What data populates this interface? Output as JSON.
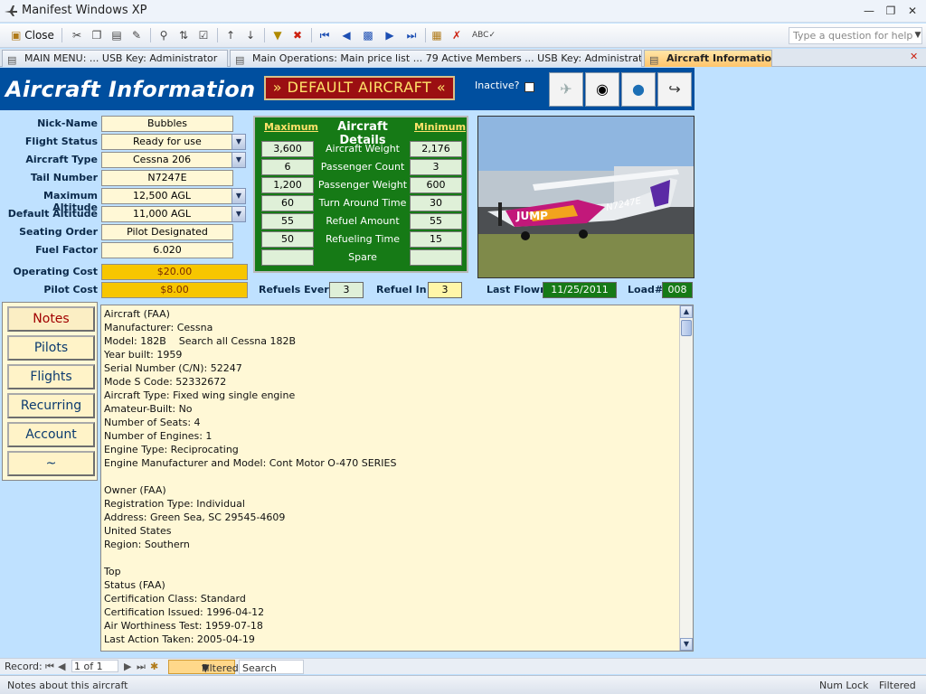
{
  "window": {
    "title": "Manifest Windows XP"
  },
  "toolbar": {
    "close_label": "Close",
    "help_placeholder": "Type a question for help"
  },
  "tabs": [
    {
      "label": "MAIN MENU:  ... USB Key:  Administrator",
      "active": false
    },
    {
      "label": "Main Operations:  Main price list ... 79 Active Members ... USB Key:  Administrator",
      "active": false
    },
    {
      "label": "Aircraft Information",
      "active": true
    }
  ],
  "header": {
    "title": "Aircraft Information",
    "default_aircraft": "» DEFAULT AIRCRAFT «",
    "inactive_label": "Inactive?"
  },
  "fields": {
    "nick_name": {
      "label": "Nick-Name",
      "value": "Bubbles"
    },
    "flight_status": {
      "label": "Flight Status",
      "value": "Ready for use"
    },
    "aircraft_type": {
      "label": "Aircraft Type",
      "value": "Cessna 206"
    },
    "tail_number": {
      "label": "Tail Number",
      "value": "N7247E"
    },
    "max_altitude": {
      "label": "Maximum Altitude",
      "value": "12,500 AGL"
    },
    "default_altitude": {
      "label": "Default Altitude",
      "value": "11,000 AGL"
    },
    "seating_order": {
      "label": "Seating Order",
      "value": "Pilot Designated"
    },
    "fuel_factor": {
      "label": "Fuel Factor",
      "value": "6.020"
    },
    "operating_cost": {
      "label": "Operating Cost",
      "value": "$20.00"
    },
    "pilot_cost": {
      "label": "Pilot Cost",
      "value": "$8.00"
    }
  },
  "details": {
    "title": "Aircraft Details",
    "max_header": "Maximum",
    "min_header": "Minimum",
    "rows": [
      {
        "label": "Aircraft Weight",
        "max": "3,600",
        "min": "2,176"
      },
      {
        "label": "Passenger Count",
        "max": "6",
        "min": "3"
      },
      {
        "label": "Passenger Weight",
        "max": "1,200",
        "min": "600"
      },
      {
        "label": "Turn Around Time",
        "max": "60",
        "min": "30"
      },
      {
        "label": "Refuel Amount",
        "max": "55",
        "min": "55"
      },
      {
        "label": "Refueling Time",
        "max": "50",
        "min": "15"
      },
      {
        "label": "Spare",
        "max": "",
        "min": ""
      }
    ]
  },
  "photo": {
    "tail_text": "N7247E",
    "livery_text": "JUMP"
  },
  "refuel": {
    "every_label": "Refuels Every",
    "every_value": "3",
    "in_label": "Refuel In",
    "in_value": "3",
    "last_flown_label": "Last Flown",
    "last_flown_value": "11/25/2011",
    "load_label": "Load#",
    "load_value": "008"
  },
  "side_buttons": [
    "Notes",
    "Pilots",
    "Flights",
    "Recurring",
    "Account",
    "~"
  ],
  "notes": "Aircraft (FAA)\nManufacturer: Cessna\nModel: 182B    Search all Cessna 182B\nYear built: 1959\nSerial Number (C/N): 52247\nMode S Code: 52332672\nAircraft Type: Fixed wing single engine\nAmateur-Built: No\nNumber of Seats: 4\nNumber of Engines: 1\nEngine Type: Reciprocating\nEngine Manufacturer and Model: Cont Motor O-470 SERIES\n\nOwner (FAA)\nRegistration Type: Individual\nAddress: Green Sea, SC 29545-4609\nUnited States\nRegion: Southern\n\nTop\nStatus (FAA)\nCertification Class: Standard\nCertification Issued: 1996-04-12\nAir Worthiness Test: 1959-07-18\nLast Action Taken: 2005-04-19",
  "record_nav": {
    "label": "Record:",
    "position": "1 of 1",
    "filtered": "Filtered",
    "search": "Search"
  },
  "status": {
    "message": "Notes about this aircraft",
    "numlock": "Num Lock",
    "filtered": "Filtered"
  }
}
